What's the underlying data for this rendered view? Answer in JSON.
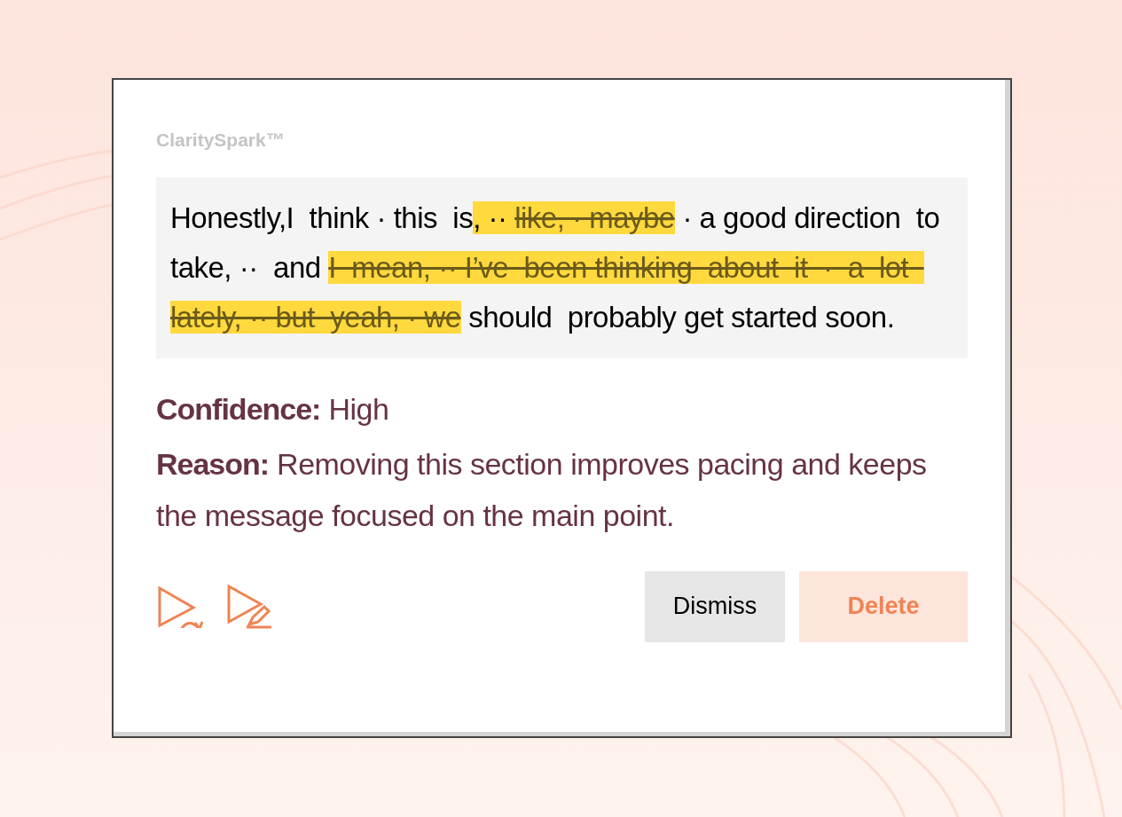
{
  "brand": "ClaritySpark™",
  "transcript": [
    {
      "kind": "plain",
      "text": "Honestly,I  think · this  is"
    },
    {
      "kind": "highlight",
      "text": ", ·· "
    },
    {
      "kind": "removed",
      "text": "like, · maybe"
    },
    {
      "kind": "plain",
      "text": " · a good direction  to  take, ··  and "
    },
    {
      "kind": "removed",
      "text": "I  mean, ·· I’ve  been thinking  about  it  ·  a  lot  lately, ·· but  yeah, · we"
    },
    {
      "kind": "plain",
      "text": " should  probably get started soon."
    }
  ],
  "details": [
    {
      "label": "Confidence:",
      "value": "High"
    },
    {
      "label": "Reason:",
      "value": "Removing this section improves pacing and keeps the message focused on the main point."
    }
  ],
  "buttons": [
    {
      "label": "Dismiss",
      "kind": "secondary"
    },
    {
      "label": "Delete",
      "kind": "danger"
    }
  ]
}
